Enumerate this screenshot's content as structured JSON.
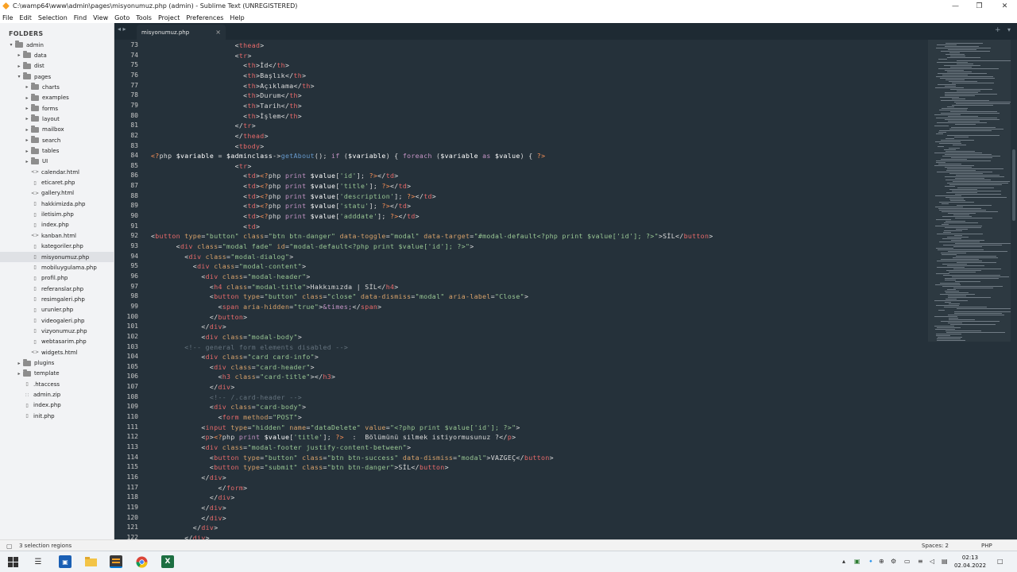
{
  "window": {
    "title": "C:\\wamp64\\www\\admin\\pages\\misyonumuz.php (admin) - Sublime Text (UNREGISTERED)"
  },
  "menu": [
    "File",
    "Edit",
    "Selection",
    "Find",
    "View",
    "Goto",
    "Tools",
    "Project",
    "Preferences",
    "Help"
  ],
  "sidebar": {
    "header": "FOLDERS",
    "items": [
      {
        "label": "admin",
        "type": "folder",
        "depth": 0,
        "open": true
      },
      {
        "label": "data",
        "type": "folder",
        "depth": 1
      },
      {
        "label": "dist",
        "type": "folder",
        "depth": 1
      },
      {
        "label": "pages",
        "type": "folder",
        "depth": 1,
        "open": true
      },
      {
        "label": "charts",
        "type": "folder",
        "depth": 2
      },
      {
        "label": "examples",
        "type": "folder",
        "depth": 2
      },
      {
        "label": "forms",
        "type": "folder",
        "depth": 2
      },
      {
        "label": "layout",
        "type": "folder",
        "depth": 2
      },
      {
        "label": "mailbox",
        "type": "folder",
        "depth": 2
      },
      {
        "label": "search",
        "type": "folder",
        "depth": 2
      },
      {
        "label": "tables",
        "type": "folder",
        "depth": 2
      },
      {
        "label": "UI",
        "type": "folder",
        "depth": 2
      },
      {
        "label": "calendar.html",
        "type": "file",
        "depth": 2
      },
      {
        "label": "eticaret.php",
        "type": "file",
        "depth": 2
      },
      {
        "label": "gallery.html",
        "type": "file",
        "depth": 2
      },
      {
        "label": "hakkimizda.php",
        "type": "file",
        "depth": 2
      },
      {
        "label": "iletisim.php",
        "type": "file",
        "depth": 2
      },
      {
        "label": "index.php",
        "type": "file",
        "depth": 2
      },
      {
        "label": "kanban.html",
        "type": "file",
        "depth": 2
      },
      {
        "label": "kategoriler.php",
        "type": "file",
        "depth": 2
      },
      {
        "label": "misyonumuz.php",
        "type": "file",
        "depth": 2,
        "selected": true
      },
      {
        "label": "mobiluygulama.php",
        "type": "file",
        "depth": 2
      },
      {
        "label": "profil.php",
        "type": "file",
        "depth": 2
      },
      {
        "label": "referanslar.php",
        "type": "file",
        "depth": 2
      },
      {
        "label": "resimgaleri.php",
        "type": "file",
        "depth": 2
      },
      {
        "label": "urunler.php",
        "type": "file",
        "depth": 2
      },
      {
        "label": "videogaleri.php",
        "type": "file",
        "depth": 2
      },
      {
        "label": "vizyonumuz.php",
        "type": "file",
        "depth": 2
      },
      {
        "label": "webtasarim.php",
        "type": "file",
        "depth": 2
      },
      {
        "label": "widgets.html",
        "type": "file",
        "depth": 2
      },
      {
        "label": "plugins",
        "type": "folder",
        "depth": 1
      },
      {
        "label": "template",
        "type": "folder",
        "depth": 1
      },
      {
        "label": ".htaccess",
        "type": "file",
        "depth": 1
      },
      {
        "label": "admin.zip",
        "type": "file",
        "depth": 1
      },
      {
        "label": "index.php",
        "type": "file",
        "depth": 1
      },
      {
        "label": "init.php",
        "type": "file",
        "depth": 1
      }
    ]
  },
  "tab": {
    "label": "misyonumuz.php",
    "close": "×"
  },
  "editor": {
    "lines": [
      {
        "n": "73",
        "code": "                    <thead>"
      },
      {
        "n": "74",
        "code": "                    <tr>"
      },
      {
        "n": "75",
        "code": "                      <th>İd</th>"
      },
      {
        "n": "76",
        "code": "                      <th>Başlık</th>"
      },
      {
        "n": "77",
        "code": "                      <th>Açıklama</th>"
      },
      {
        "n": "78",
        "code": "                      <th>Durum</th>"
      },
      {
        "n": "79",
        "code": "                      <th>Tarih</th>"
      },
      {
        "n": "80",
        "code": "                      <th>İşlem</th>"
      },
      {
        "n": "81",
        "code": "                    </tr>"
      },
      {
        "n": "82",
        "code": "                    </thead>"
      },
      {
        "n": "83",
        "code": "                    <tbody>"
      },
      {
        "n": "84",
        "code": "<?php $variable = $adminclass->getAbout(); if ($variable) { foreach ($variable as $value) { ?>"
      },
      {
        "n": "85",
        "code": "                    <tr>"
      },
      {
        "n": "86",
        "code": "                      <td><?php print $value['id']; ?></td>"
      },
      {
        "n": "87",
        "code": "                      <td><?php print $value['title']; ?></td>"
      },
      {
        "n": "88",
        "code": "                      <td><?php print $value['description']; ?></td>"
      },
      {
        "n": "89",
        "code": "                      <td><?php print $value['statu']; ?></td>"
      },
      {
        "n": "90",
        "code": "                      <td><?php print $value['adddate']; ?></td>"
      },
      {
        "n": "91",
        "code": "                      <td>"
      },
      {
        "n": "92",
        "code": "<button type=\"button\" class=\"btn btn-danger\" data-toggle=\"modal\" data-target=\"#modal-default<?php print $value['id']; ?>\">SİL</button>"
      },
      {
        "n": "93",
        "code": "      <div class=\"modal fade\" id=\"modal-default<?php print $value['id']; ?>\">"
      },
      {
        "n": "94",
        "code": "        <div class=\"modal-dialog\">"
      },
      {
        "n": "95",
        "code": "          <div class=\"modal-content\">"
      },
      {
        "n": "96",
        "code": "            <div class=\"modal-header\">"
      },
      {
        "n": "97",
        "code": "              <h4 class=\"modal-title\">Hakkımızda | SİL</h4>"
      },
      {
        "n": "98",
        "code": "              <button type=\"button\" class=\"close\" data-dismiss=\"modal\" aria-label=\"Close\">"
      },
      {
        "n": "99",
        "code": "                <span aria-hidden=\"true\">&times;</span>"
      },
      {
        "n": "100",
        "code": "              </button>"
      },
      {
        "n": "101",
        "code": "            </div>"
      },
      {
        "n": "102",
        "code": "            <div class=\"modal-body\">"
      },
      {
        "n": "103",
        "code": "        <!-- general form elements disabled -->"
      },
      {
        "n": "104",
        "code": "            <div class=\"card card-info\">"
      },
      {
        "n": "105",
        "code": "              <div class=\"card-header\">"
      },
      {
        "n": "106",
        "code": "                <h3 class=\"card-title\"></h3>"
      },
      {
        "n": "107",
        "code": "              </div>"
      },
      {
        "n": "108",
        "code": "              <!-- /.card-header -->"
      },
      {
        "n": "109",
        "code": "              <div class=\"card-body\">"
      },
      {
        "n": "110",
        "code": "                <form method=\"POST\">"
      },
      {
        "n": "111",
        "code": "            <input type=\"hidden\" name=\"dataDelete\" value=\"<?php print $value['id']; ?>\">"
      },
      {
        "n": "112",
        "code": "            <p><?php print $value['title']; ?>  :  Bölümünü silmek istiyormusunuz ?</p>"
      },
      {
        "n": "113",
        "code": "            <div class=\"modal-footer justify-content-between\">"
      },
      {
        "n": "114",
        "code": "              <button type=\"button\" class=\"btn btn-success\" data-dismiss=\"modal\">VAZGEÇ</button>"
      },
      {
        "n": "115",
        "code": "              <button type=\"submit\" class=\"btn btn-danger\">SİL</button>"
      },
      {
        "n": "116",
        "code": "            </div>"
      },
      {
        "n": "117",
        "code": "                </form>"
      },
      {
        "n": "118",
        "code": "              </div>"
      },
      {
        "n": "119",
        "code": "            </div>"
      },
      {
        "n": "120",
        "code": "            </div>"
      },
      {
        "n": "121",
        "code": "          </div>"
      },
      {
        "n": "122",
        "code": "        </div>"
      }
    ]
  },
  "status": {
    "left": "3 selection regions",
    "spaces": "Spaces: 2",
    "syntax": "PHP"
  },
  "clock": {
    "time": "02:13",
    "date": "02.04.2022"
  }
}
